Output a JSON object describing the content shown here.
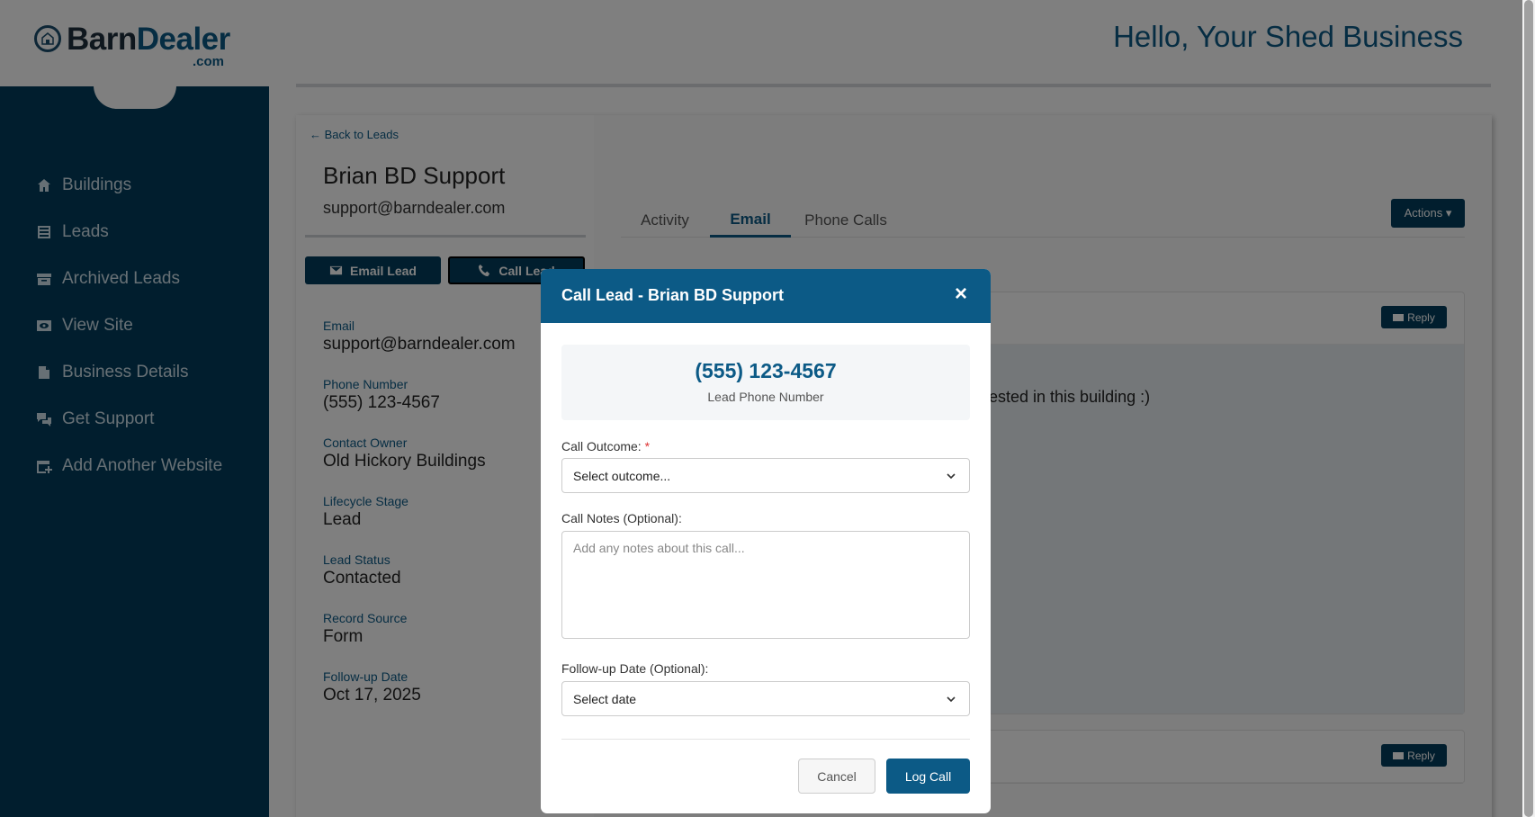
{
  "brand": {
    "name_part1": "Barn",
    "name_part2": "Dealer",
    "domain": ".com"
  },
  "sidebar": {
    "items": [
      {
        "label": "Buildings",
        "icon": "home-icon"
      },
      {
        "label": "Leads",
        "icon": "list-icon"
      },
      {
        "label": "Archived Leads",
        "icon": "archive-icon"
      },
      {
        "label": "View Site",
        "icon": "eye-icon"
      },
      {
        "label": "Business Details",
        "icon": "document-icon"
      },
      {
        "label": "Get Support",
        "icon": "chat-icon"
      },
      {
        "label": "Add Another Website",
        "icon": "add-window-icon"
      }
    ]
  },
  "header": {
    "greeting": "Hello, Your Shed Business"
  },
  "lead": {
    "back_label": "← Back to Leads",
    "name": "Brian BD Support",
    "email": "support@barndealer.com",
    "email_button": "Email Lead",
    "call_button": "Call Lead",
    "fields": [
      {
        "label": "Email",
        "value": "support@barndealer.com"
      },
      {
        "label": "Phone Number",
        "value": "(555) 123-4567"
      },
      {
        "label": "Contact Owner",
        "value": "Old Hickory Buildings"
      },
      {
        "label": "Lifecycle Stage",
        "value": "Lead"
      },
      {
        "label": "Lead Status",
        "value": "Contacted"
      },
      {
        "label": "Record Source",
        "value": "Form"
      },
      {
        "label": "Follow-up Date",
        "value": "Oct 17, 2025"
      }
    ]
  },
  "tabs": [
    {
      "label": "Activity"
    },
    {
      "label": "Email"
    },
    {
      "label": "Phone Calls"
    }
  ],
  "actions_label": "Actions ▾",
  "messages": [
    {
      "reply_label": "Reply",
      "text_fragment": "ested in this building :)"
    },
    {
      "reply_label": "Reply"
    }
  ],
  "modal": {
    "title": "Call Lead - Brian BD Support",
    "close": "×",
    "phone": "(555) 123-4567",
    "phone_caption": "Lead Phone Number",
    "outcome_label": "Call Outcome:",
    "required_mark": "*",
    "outcome_value": "Select outcome...",
    "notes_label": "Call Notes (Optional):",
    "notes_placeholder": "Add any notes about this call...",
    "followup_label": "Follow-up Date (Optional):",
    "followup_value": "Select date",
    "cancel": "Cancel",
    "submit": "Log Call"
  },
  "colors": {
    "primary": "#0c5a86",
    "sidebar": "#033d5c",
    "required": "#dd3333"
  }
}
